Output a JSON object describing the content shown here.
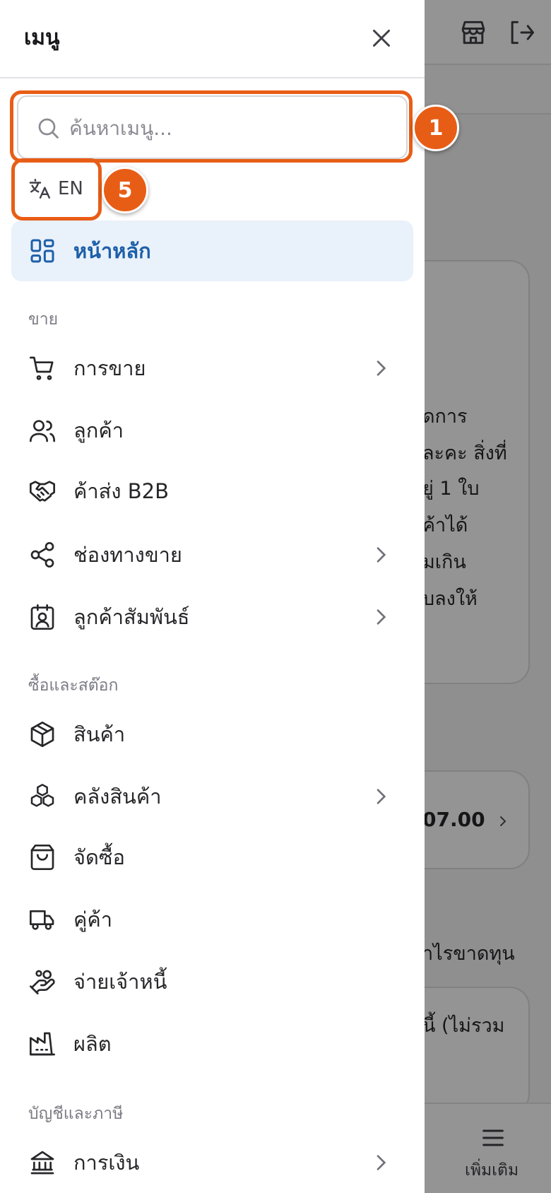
{
  "drawer": {
    "title": "เมนู",
    "search_placeholder": "ค้นหาเมนู...",
    "language_label": "EN",
    "home_label": "หน้าหลัก",
    "sections": {
      "sales": "ขาย",
      "purchase_stock": "ซื้อและสต๊อก",
      "accounting_tax": "บัญชีและภาษี"
    },
    "items": {
      "sales": "การขาย",
      "customers": "ลูกค้า",
      "wholesale": "ค้าส่ง B2B",
      "channels": "ช่องทางขาย",
      "crm": "ลูกค้าสัมพันธ์",
      "products": "สินค้า",
      "warehouse": "คลังสินค้า",
      "purchasing": "จัดซื้อ",
      "suppliers": "คู่ค้า",
      "payables": "จ่ายเจ้าหนี้",
      "manufacturing": "ผลิต",
      "finance": "การเงิน"
    }
  },
  "annotations": {
    "search_marker": "1",
    "language_marker": "5"
  },
  "background": {
    "card_text_lines": [
      "ดการ",
      "ละคะ สิ่งที่",
      "ยู่ 1 ใบ",
      "ค้าได้",
      "มเกิน",
      "บลงให้"
    ],
    "amount": "07.00",
    "profit_label": "ำไรขาดทุน",
    "card3_text": "นี้ (ไม่รวม",
    "more_label": "เพิ่มเติม"
  },
  "colors": {
    "accent": "#e85d16",
    "active_bg": "#e9f1fb",
    "active_text": "#1d5fa8"
  }
}
